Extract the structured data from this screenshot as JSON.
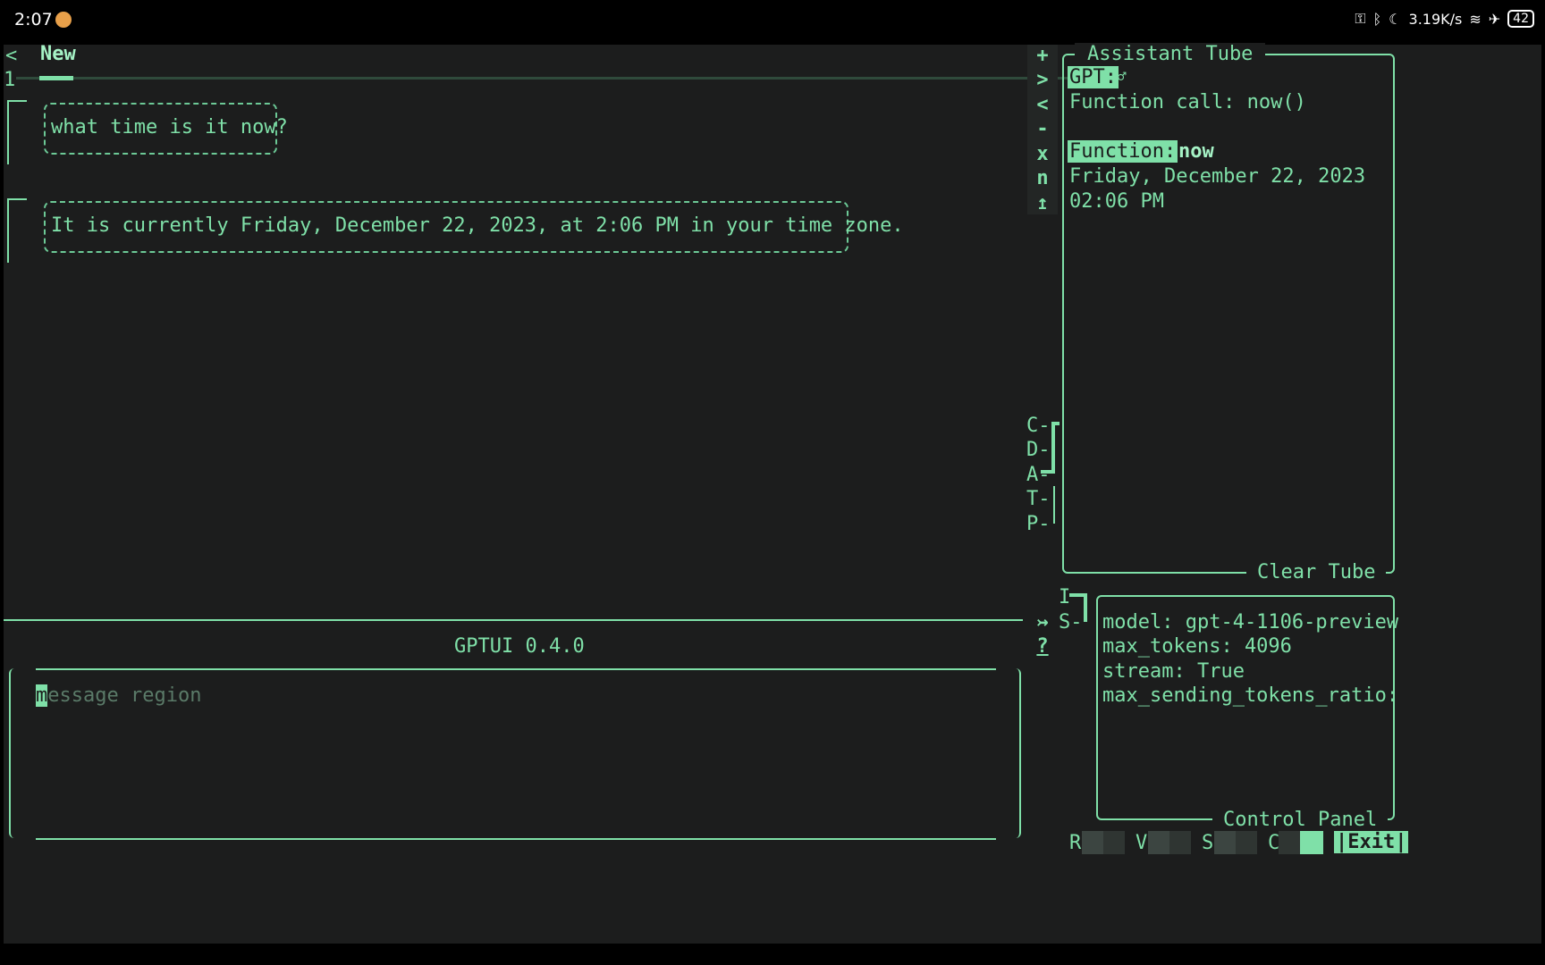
{
  "status_bar": {
    "time": "2:07",
    "network_speed": "3.19K/s",
    "battery": "42"
  },
  "tab_bar": {
    "left_arrow": "<",
    "right_arrow": ">",
    "active_tab": "New",
    "index": "1",
    "edge_mark": "♂"
  },
  "chat": {
    "messages": [
      {
        "role": "user",
        "text": "what time is it now?"
      },
      {
        "role": "assistant",
        "text": "It is currently Friday, December 22, 2023, at 2:06 PM in your time zone."
      }
    ]
  },
  "side_toolbar": {
    "buttons": [
      "+",
      ">",
      "<",
      "-",
      "x",
      "n",
      "↥"
    ],
    "plugin_labels": [
      "C-",
      "D-",
      "A-",
      "T-",
      "P-"
    ],
    "bottom_buttons": [
      "↣",
      "?"
    ]
  },
  "assistant_tube": {
    "title": "Assistant Tube",
    "gpt_label": "GPT:",
    "function_call": "Function call: now()",
    "function_label": "Function:",
    "function_name": "now",
    "result_line1": "Friday, December 22, 2023",
    "result_line2": "02:06 PM",
    "clear_label": "Clear Tube"
  },
  "panel_toggles": {
    "i": "I",
    "s": "S-"
  },
  "control_panel": {
    "title": "Control Panel",
    "lines": [
      "model: gpt-4-1106-preview",
      "max_tokens: 4096",
      "stream: True",
      "max_sending_tokens_ratio:"
    ]
  },
  "app_title": "GPTUI 0.4.0",
  "input": {
    "placeholder": "message region",
    "cursor_char": "m",
    "rest": "essage region"
  },
  "bottom_bar": {
    "r": "R",
    "v": "V",
    "s": "S",
    "c": "C",
    "exit": "|Exit|"
  },
  "colors": {
    "accent": "#7fe0a8",
    "background": "#1c1d1d"
  }
}
